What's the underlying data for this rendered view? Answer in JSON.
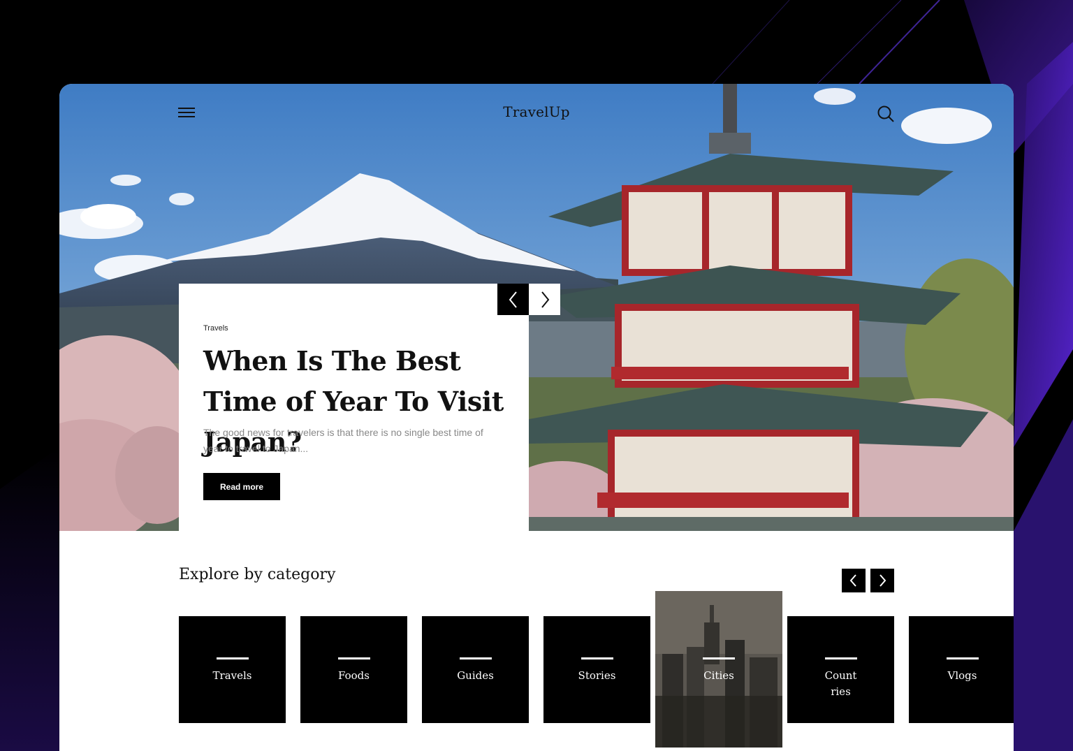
{
  "header": {
    "brand": "TravelUp",
    "menu_icon": "hamburger-menu-icon",
    "search_icon": "search-icon"
  },
  "hero": {
    "category": "Travels",
    "title": "When Is The Best Time of Year To Visit Japan?",
    "excerpt": "The good news for travelers is that there is no single best time of year to travel to Japan...",
    "cta_label": "Read more",
    "prev_icon": "chevron-left-icon",
    "next_icon": "chevron-right-icon"
  },
  "explore": {
    "heading": "Explore by category",
    "categories": [
      {
        "label": "Travels"
      },
      {
        "label": "Foods"
      },
      {
        "label": "Guides"
      },
      {
        "label": "Stories"
      },
      {
        "label": "Cities",
        "featured": true
      },
      {
        "label": "Count\nries"
      },
      {
        "label": "Vlogs"
      }
    ]
  },
  "colors": {
    "accent": "#000000",
    "background": "#000000",
    "glow": "#6a2cff"
  }
}
